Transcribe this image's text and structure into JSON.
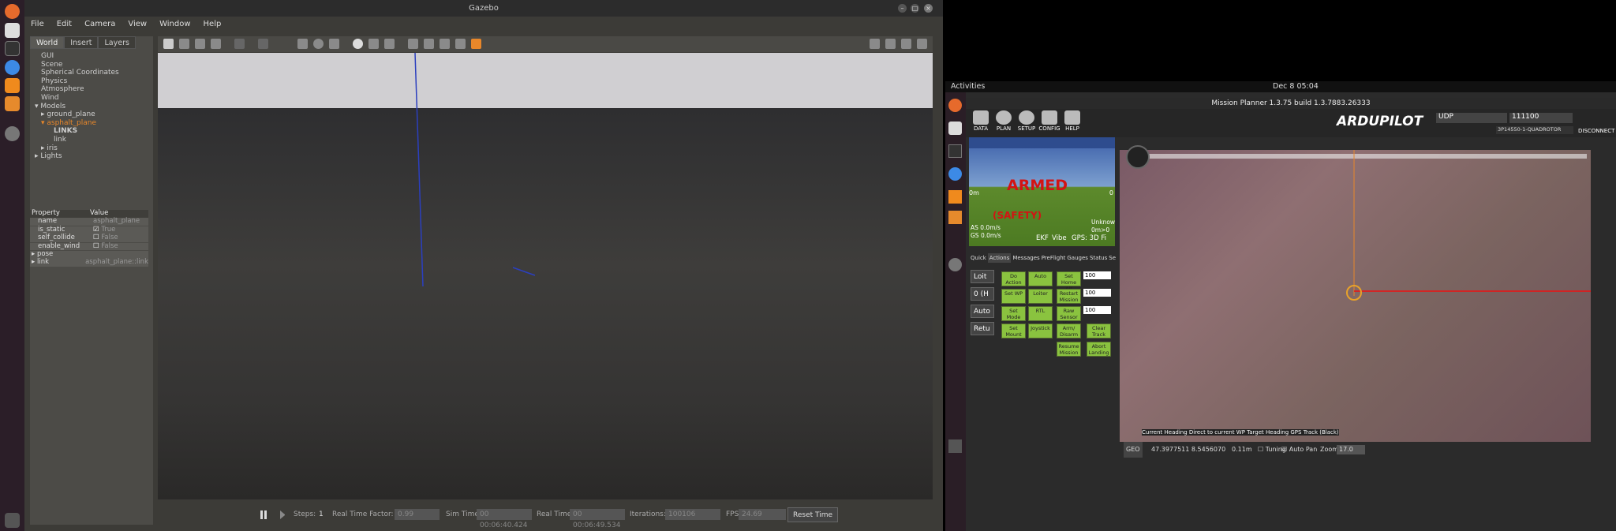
{
  "gazebo": {
    "title": "Gazebo",
    "menu": [
      "File",
      "Edit",
      "Camera",
      "View",
      "Window",
      "Help"
    ],
    "tabs": [
      "World",
      "Insert",
      "Layers"
    ],
    "tree": [
      {
        "label": "GUI",
        "indent": 1
      },
      {
        "label": "Scene",
        "indent": 1
      },
      {
        "label": "Spherical Coordinates",
        "indent": 1
      },
      {
        "label": "Physics",
        "indent": 1
      },
      {
        "label": "Atmosphere",
        "indent": 1
      },
      {
        "label": "Wind",
        "indent": 1
      },
      {
        "label": "Models",
        "indent": 0,
        "arrow": "▾"
      },
      {
        "label": "ground_plane",
        "indent": 1,
        "arrow": "▸"
      },
      {
        "label": "asphalt_plane",
        "indent": 1,
        "arrow": "▾",
        "highlight": true
      },
      {
        "label": "LINKS",
        "indent": 3,
        "bold": true
      },
      {
        "label": "link",
        "indent": 3
      },
      {
        "label": "iris",
        "indent": 1,
        "arrow": "▸"
      },
      {
        "label": "Lights",
        "indent": 0,
        "arrow": "▸"
      }
    ],
    "props": {
      "h_property": "Property",
      "h_value": "Value",
      "rows": [
        {
          "k": "name",
          "v": "asphalt_plane"
        },
        {
          "k": "is_static",
          "v": "True",
          "check": true
        },
        {
          "k": "self_collide",
          "v": "False",
          "check": false
        },
        {
          "k": "enable_wind",
          "v": "False",
          "check": false
        },
        {
          "k": "pose",
          "v": "",
          "arrow": true
        },
        {
          "k": "link",
          "v": "asphalt_plane::link",
          "arrow": true
        }
      ]
    },
    "bottom": {
      "steps_label": "Steps:",
      "steps": "1",
      "rtf_label": "Real Time Factor:",
      "rtf": "0.99",
      "sim_label": "Sim Time:",
      "sim": "00 00:06:40.424",
      "real_label": "Real Time:",
      "real": "00 00:06:49.534",
      "iter_label": "Iterations:",
      "iter": "100106",
      "fps_label": "FPS:",
      "fps": "24.69",
      "reset": "Reset Time"
    }
  },
  "activities": {
    "label": "Activities",
    "clock": "Dec 8  05:04"
  },
  "mission_planner": {
    "title": "Mission Planner 1.3.75 build 1.3.7883.26333",
    "nav": [
      "DATA",
      "PLAN",
      "SETUP",
      "CONFIG",
      "HELP"
    ],
    "logo": "ARDUPILOT",
    "conn_type": "UDP",
    "baud": "111100",
    "vehicle": "3P14550-1-QUADROTOR",
    "disconnect": "DISCONNECT",
    "hud": {
      "armed": "ARMED",
      "safety": "(SAFETY)",
      "ekf": "EKF",
      "vibe": "Vibe",
      "gps": "GPS: 3D Fi",
      "as": "AS 0.0m/s",
      "gs": "GS 0.0m/s",
      "unknown": "Unknow",
      "alt": "0m>0",
      "left_speed": "0m",
      "right_speed": "0"
    },
    "ctabs": [
      "Quick",
      "Actions",
      "Messages",
      "PreFlight",
      "Gauges",
      "Status",
      "Se"
    ],
    "selects": [
      "Loit",
      "0 (H",
      "Auto",
      "Retu"
    ],
    "actions": [
      {
        "l": "Do Action",
        "c": 0,
        "r": 0
      },
      {
        "l": "Auto",
        "c": 1,
        "r": 0
      },
      {
        "l": "Set Home Alt",
        "c": 2,
        "r": 0
      },
      {
        "l": "Set WP",
        "c": 0,
        "r": 1
      },
      {
        "l": "Loiter",
        "c": 1,
        "r": 1
      },
      {
        "l": "Restart Mission",
        "c": 2,
        "r": 1
      },
      {
        "l": "Set Mode",
        "c": 0,
        "r": 2
      },
      {
        "l": "RTL",
        "c": 1,
        "r": 2
      },
      {
        "l": "Raw Sensor View",
        "c": 2,
        "r": 2
      },
      {
        "l": "Set Mount",
        "c": 0,
        "r": 3
      },
      {
        "l": "Joystick",
        "c": 1,
        "r": 3
      },
      {
        "l": "Arm/ Disarm",
        "c": 2,
        "r": 3
      },
      {
        "l": "Clear Track",
        "c": 3,
        "r": 3
      },
      {
        "l": "Resume Mission",
        "c": 2,
        "r": 4
      },
      {
        "l": "Abort Landing",
        "c": 3,
        "r": 4
      }
    ],
    "spins": [
      "100",
      "100",
      "100"
    ],
    "map_legend": "Current Heading Direct to current WP Target Heading GPS Track (Black)",
    "map_status": {
      "geo": "GEO",
      "coords": "47.3977511  8.5456070",
      "dist": "0.11m",
      "tuning": "Tuning",
      "autopan": "Auto Pan",
      "zoom_label": "Zoom",
      "zoom": "17.0"
    }
  }
}
